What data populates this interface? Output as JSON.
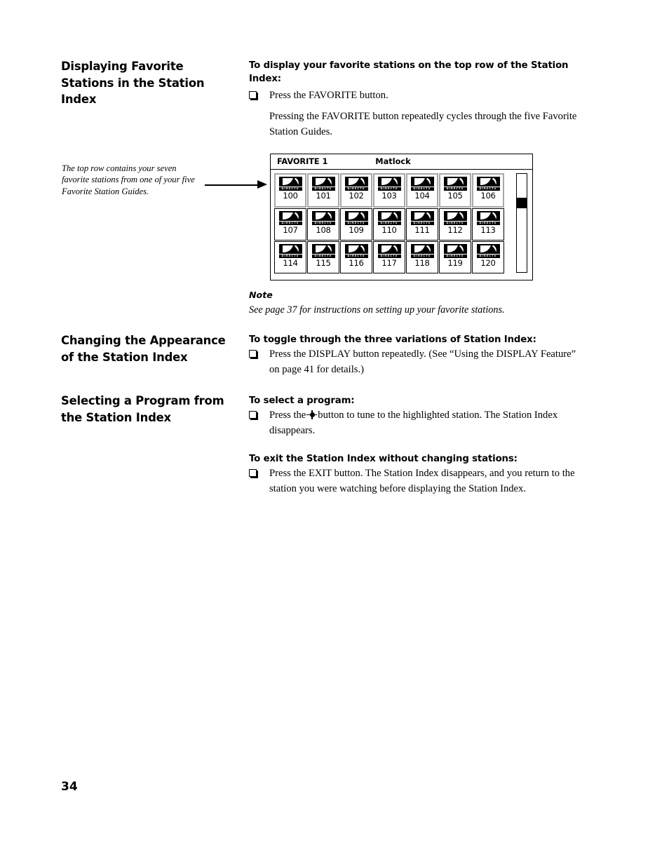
{
  "page": {
    "number": "34"
  },
  "sections": {
    "displaying": {
      "heading": "Displaying Favorite Stations in the Station Index",
      "caption": "The top row contains your seven favorite stations from one of your five Favorite Station Guides.",
      "sub_heading": "To display your favorite stations on the top row of the Station Index:",
      "bullet": "Press the FAVORITE button.",
      "paragraph": "Pressing the FAVORITE button repeatedly cycles through the five Favorite Station Guides.",
      "note_label": "Note",
      "note_body": "See page 37 for instructions on setting up your favorite stations."
    },
    "changing": {
      "heading": "Changing the Appearance of the Station Index",
      "sub_heading": "To toggle through the three variations of Station Index:",
      "bullet": "Press the DISPLAY button repeatedly. (See “Using the DISPLAY Feature” on page 41 for details.)"
    },
    "selecting": {
      "heading": "Selecting a Program from the Station Index",
      "sub_heading_select": "To select a program:",
      "bullet_select_before": "Press the",
      "bullet_select_after": "button to tune to the highlighted station. The Station Index disappears.",
      "sub_heading_exit": "To exit the Station Index without changing stations:",
      "bullet_exit": "Press the EXIT button. The Station Index disappears, and you return to the station you were watching before displaying the Station Index."
    }
  },
  "station_index": {
    "favorite_label": "FAVORITE 1",
    "program_title": "Matlock",
    "logo_text": "DIRECTV",
    "highlight_color": "#a8a8a8",
    "rows": [
      {
        "highlighted": true,
        "channels": [
          "100",
          "101",
          "102",
          "103",
          "104",
          "105",
          "106"
        ]
      },
      {
        "highlighted": false,
        "channels": [
          "107",
          "108",
          "109",
          "110",
          "111",
          "112",
          "113"
        ]
      },
      {
        "highlighted": false,
        "channels": [
          "114",
          "115",
          "116",
          "117",
          "118",
          "119",
          "120"
        ]
      }
    ]
  }
}
